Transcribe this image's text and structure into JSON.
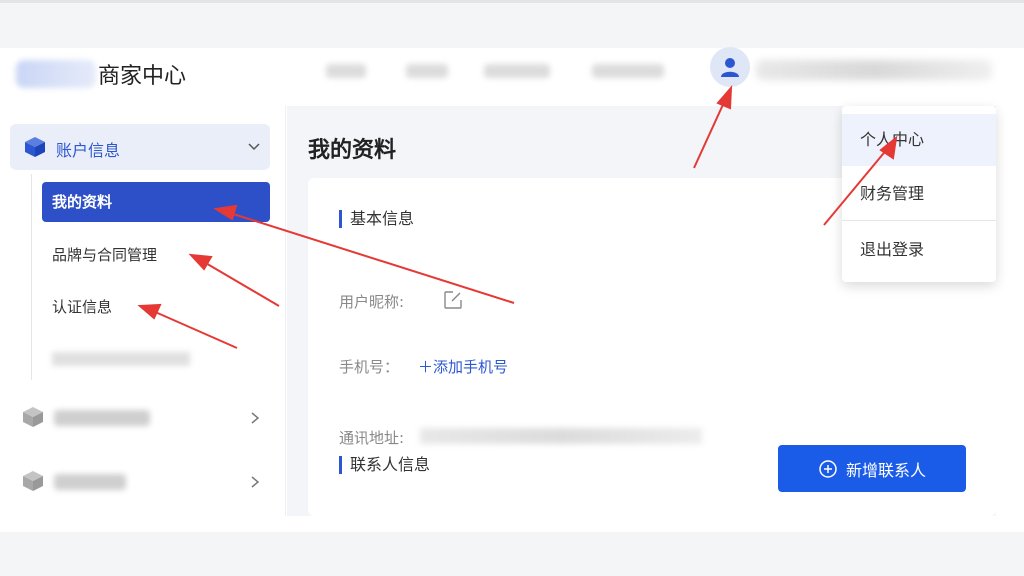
{
  "header": {
    "brand": "商家中心"
  },
  "sidebar": {
    "group_label": "账户信息",
    "items": [
      {
        "label": "我的资料",
        "active": true
      },
      {
        "label": "品牌与合同管理",
        "active": false
      },
      {
        "label": "认证信息",
        "active": false
      }
    ]
  },
  "main": {
    "page_title": "我的资料",
    "basic_section": "基本信息",
    "nickname_label": "用户昵称:",
    "phone_label": "手机号：",
    "add_phone": "＋添加手机号",
    "address_label": "通讯地址:",
    "contact_section": "联系人信息",
    "new_contact_button": "新增联系人"
  },
  "dropdown": {
    "items": [
      "个人中心",
      "财务管理",
      "退出登录"
    ]
  },
  "colors": {
    "accent": "#2d57d1",
    "active_item": "#2d4fc7",
    "primary_button": "#1a5be8",
    "annotation_arrow": "#e53935"
  }
}
